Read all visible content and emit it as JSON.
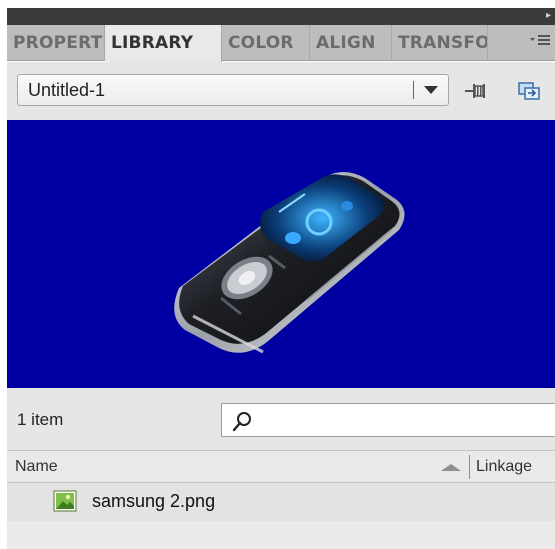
{
  "panel": {
    "collapse_arrow": "▸"
  },
  "tabs": [
    {
      "label": "PROPERTIES",
      "active": false
    },
    {
      "label": "LIBRARY",
      "active": true
    },
    {
      "label": "COLOR",
      "active": false
    },
    {
      "label": "ALIGN",
      "active": false
    },
    {
      "label": "TRANSFORM",
      "active": false
    }
  ],
  "tab_menu_icon": "panel-menu-icon",
  "library": {
    "document": "Untitled-1",
    "pin_icon": "pin-library-icon",
    "new_library_icon": "new-library-panel-icon"
  },
  "preview": {
    "background": "#0000a2",
    "subject": "mp3-player-image"
  },
  "status": {
    "count": "1 item",
    "search_value": "",
    "search_icon": "search-icon"
  },
  "columns": {
    "name": "Name",
    "linkage": "Linkage"
  },
  "items": [
    {
      "name": "samsung 2.png",
      "icon": "bitmap-icon"
    }
  ]
}
